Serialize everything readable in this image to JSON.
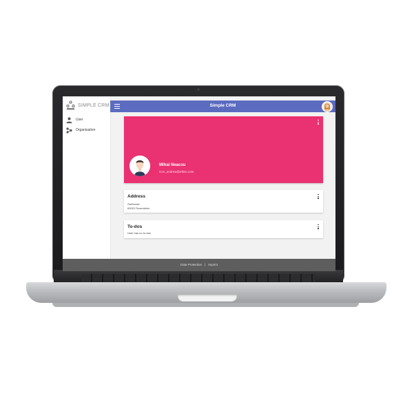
{
  "app": {
    "logo_text": "SIMPLE CRM",
    "title": "Simple CRM"
  },
  "sidebar": {
    "items": [
      {
        "label": "User",
        "icon": "person-icon"
      },
      {
        "label": "Organisation",
        "icon": "organisation-icon"
      }
    ]
  },
  "profile": {
    "name": "Mihai Neacsu",
    "email": "icon_andrew@ellino.com"
  },
  "address_card": {
    "title": "Address",
    "lines": [
      "Gießenstr.",
      "83022 Rosenheim"
    ]
  },
  "todos_card": {
    "title": "To-dos",
    "empty_text": "User has no to-dos"
  },
  "footer": {
    "data_protection": "Data Protection",
    "separator": "|",
    "imprint": "Imprint"
  },
  "colors": {
    "header": "#5b6bc0",
    "profile_card": "#ea3171",
    "footer": "#5e5e5e"
  }
}
